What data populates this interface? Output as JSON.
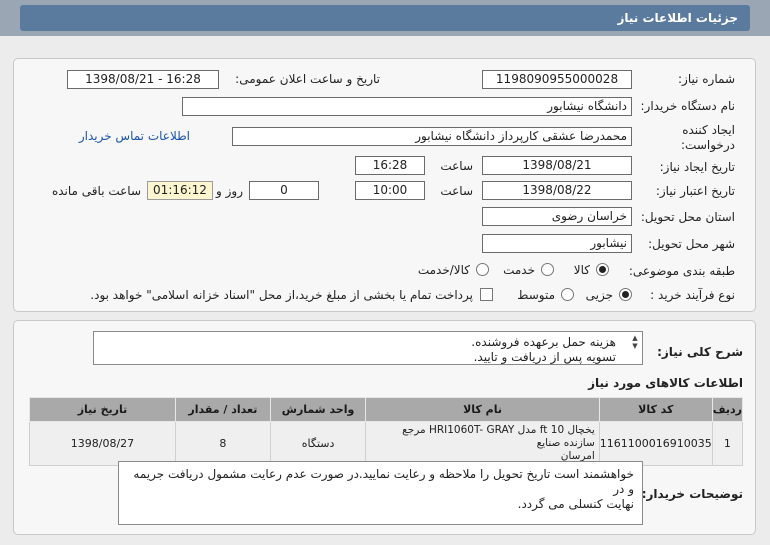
{
  "page": {
    "title": "جزئیات اطلاعات نیاز"
  },
  "form": {
    "need_number": {
      "label": "شماره نیاز:",
      "value": "1198090955000028"
    },
    "announce": {
      "label": "تاریخ و ساعت اعلان عمومی:",
      "value": "1398/08/21 - 16:28"
    },
    "buyer": {
      "label": "نام دستگاه خریدار:",
      "value": "دانشگاه نیشابور"
    },
    "creator": {
      "label_line1": "ایجاد کننده",
      "label_line2": "درخواست:",
      "value": "محمدرضا عشقی کارپرداز دانشگاه نیشابور",
      "contact_link": "اطلاعات تماس خریدار"
    },
    "created": {
      "label": "تاریخ ایجاد نیاز:",
      "date": "1398/08/21",
      "time_label": "ساعت",
      "time": "16:28"
    },
    "validity": {
      "label": "تاریخ اعتبار نیاز:",
      "date": "1398/08/22",
      "time_label": "ساعت",
      "time": "10:00",
      "days": "0",
      "days_label": "روز و",
      "remaining": "01:16:12",
      "remaining_label": "ساعت باقی مانده"
    },
    "province": {
      "label": "استان محل تحویل:",
      "value": "خراسان رضوی"
    },
    "city": {
      "label": "شهر محل تحویل:",
      "value": "نیشابور"
    },
    "category": {
      "label": "طبقه بندی موضوعی:",
      "options": [
        "کالا",
        "خدمت",
        "کالا/خدمت"
      ],
      "selected": "کالا"
    },
    "purchase_type": {
      "label": "نوع فرآیند خرید :",
      "options": [
        "جزیی",
        "متوسط"
      ],
      "selected": "جزیی",
      "note": "پرداخت تمام یا بخشی از مبلغ خرید،از محل \"اسناد خزانه اسلامی\" خواهد بود."
    }
  },
  "general_desc": {
    "label": "شرح کلی نیاز:",
    "lines": [
      "هزینه حمل برعهده فروشنده.",
      "تسویه پس از دریافت و تایید."
    ]
  },
  "goods": {
    "title": "اطلاعات کالاهای مورد نیاز",
    "columns": [
      "ردیف",
      "کد کالا",
      "نام کالا",
      "واحد شمارش",
      "تعداد / مقدار",
      "تاریخ نیاز"
    ],
    "rows": [
      {
        "row": "1",
        "code": "1161100016910035",
        "name_line1": "یخچال 10 ft مدل HRI1060T- GRAY مرجع سازنده صنایع",
        "name_line2": "امرسان",
        "unit": "دستگاه",
        "qty": "8",
        "date": "1398/08/27"
      }
    ]
  },
  "buyer_notes": {
    "label": "توضیحات خریدار:",
    "lines": [
      "خواهشمند است تاریخ تحویل را ملاحظه و رعایت نمایید.در صورت عدم رعایت مشمول دریافت جریمه و در",
      "نهایت کنسلی می گردد."
    ]
  },
  "colors": {
    "header_bg": "#9aa6b4",
    "title_bar": "#5a7a9e",
    "table_header": "#a9a9a9",
    "link": "#1a55a8",
    "remaining_bg": "#fbf6d0"
  }
}
